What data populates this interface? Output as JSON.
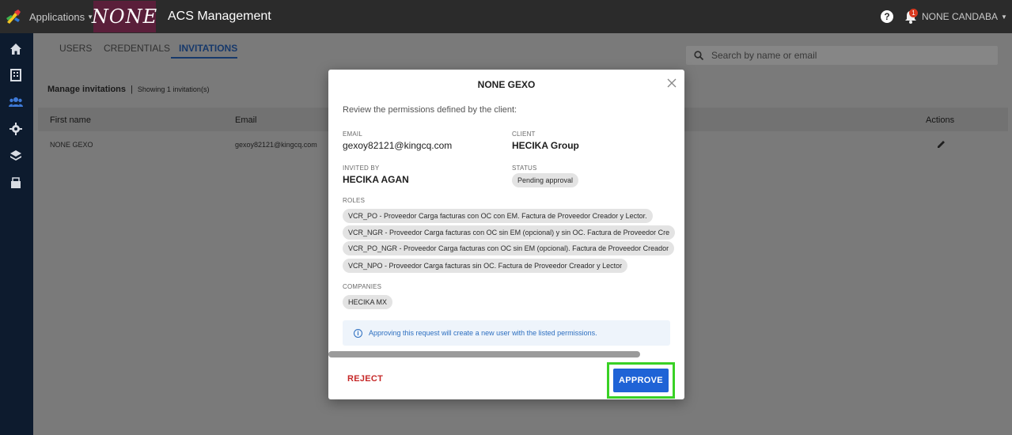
{
  "topbar": {
    "apps_label": "Applications",
    "brand_text": "NONE",
    "app_title": "ACS Management",
    "help_glyph": "?",
    "notification_count": "1",
    "user_name": "NONE CANDABA"
  },
  "sidebar": {
    "icons": [
      "home-icon",
      "building-icon",
      "users-icon",
      "gear-icon",
      "layers-icon",
      "folder-icon"
    ]
  },
  "tabs": [
    {
      "label": "USERS",
      "active": false
    },
    {
      "label": "CREDENTIALS",
      "active": false
    },
    {
      "label": "INVITATIONS",
      "active": true
    }
  ],
  "search": {
    "placeholder": "Search by name or email"
  },
  "card": {
    "title": "Manage invitations",
    "separator": "|",
    "count_text": "Showing 1 invitation(s)",
    "columns": {
      "first_name": "First name",
      "email": "Email",
      "actions": "Actions"
    },
    "rows": [
      {
        "first_name": "NONE GEXO",
        "email": "gexoy82121@kingcq.com"
      }
    ]
  },
  "modal": {
    "title": "NONE GEXO",
    "intro": "Review the permissions defined by the client:",
    "email_label": "EMAIL",
    "email_value": "gexoy82121@kingcq.com",
    "client_label": "CLIENT",
    "client_value": "HECIKA Group",
    "invited_by_label": "INVITED BY",
    "invited_by_value": "HECIKA AGAN",
    "status_label": "STATUS",
    "status_value": "Pending approval",
    "roles_label": "ROLES",
    "roles": [
      "VCR_PO - Proveedor Carga facturas con OC con EM. Factura de Proveedor Creador y Lector.",
      "VCR_NGR - Proveedor Carga facturas con OC sin EM (opcional) y sin OC. Factura de Proveedor Cre",
      "VCR_PO_NGR - Proveedor Carga facturas con OC sin EM (opcional). Factura de Proveedor Creador",
      "VCR_NPO - Proveedor Carga facturas sin OC. Factura de Proveedor Creador y Lector"
    ],
    "companies_label": "COMPANIES",
    "companies": [
      "HECIKA MX"
    ],
    "info_glyph": "i",
    "info_text": "Approving this request will create a new user with the listed permissions.",
    "reject_label": "REJECT",
    "approve_label": "APPROVE"
  },
  "colors": {
    "brand_bg": "#5a1f3a",
    "accent": "#1f63d6",
    "reject": "#c62828",
    "highlight": "#39d125",
    "sidebar_bg": "#0d1b2e"
  }
}
